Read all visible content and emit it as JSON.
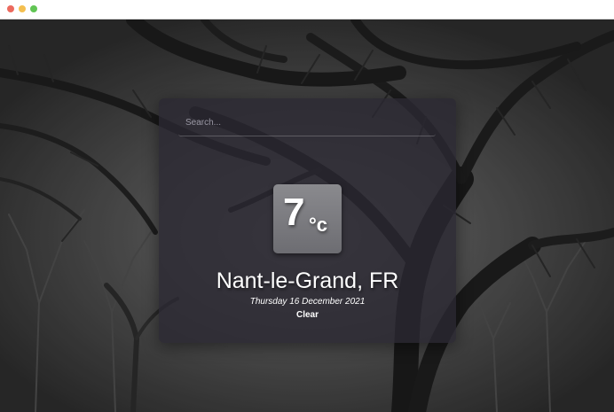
{
  "window": {
    "controls": [
      "close",
      "minimize",
      "maximize"
    ]
  },
  "search": {
    "placeholder": "Search..."
  },
  "weather": {
    "temperature": "7",
    "unit": "°c",
    "location": "Nant-le-Grand, FR",
    "date": "Thursday 16 December 2021",
    "condition": "Clear"
  },
  "theme": {
    "card": "#2a2832",
    "temp_box": "#7a7a7e",
    "text": "#ffffff"
  }
}
